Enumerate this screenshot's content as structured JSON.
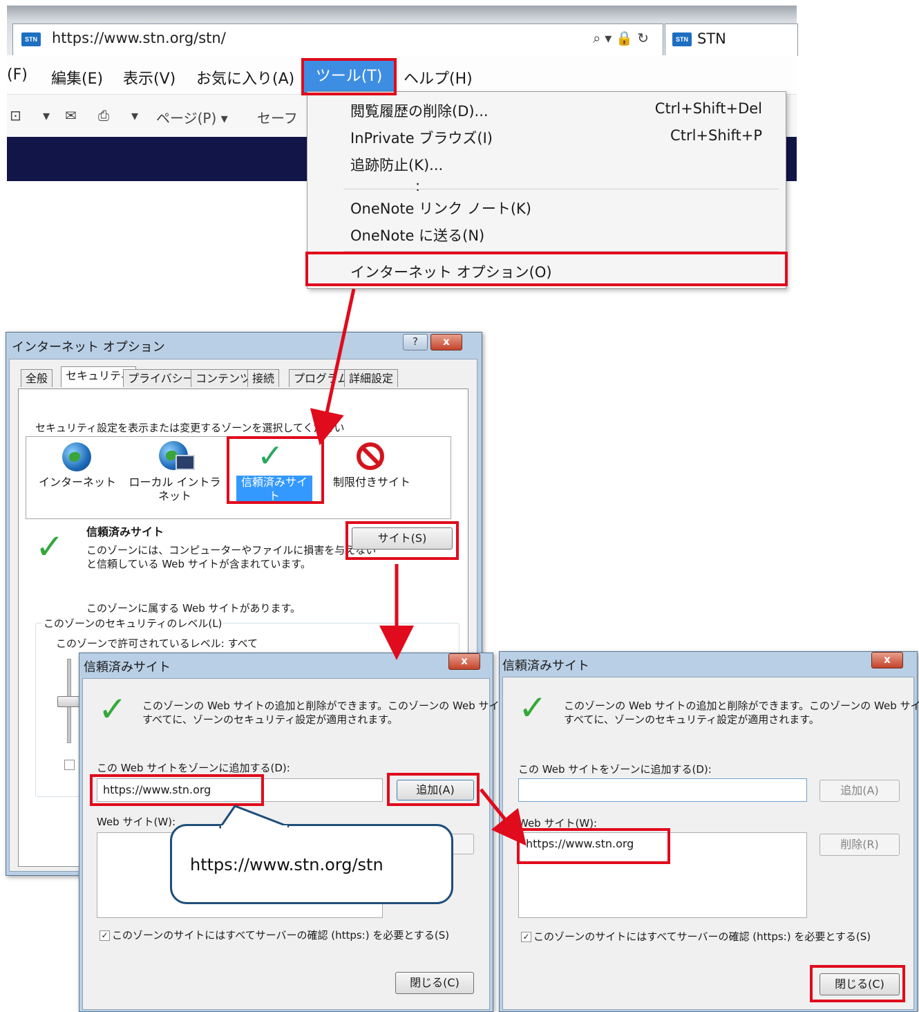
{
  "browser": {
    "url": "https://www.stn.org/stn/",
    "favicon_text": "STN",
    "tab_title": "STN",
    "address_icons": "⌕▾🔒↻"
  },
  "menubar": {
    "items": [
      "(F)",
      "編集(E)",
      "表示(V)",
      "お気に入り(A)",
      "ツール(T)",
      "ヘルプ(H)"
    ]
  },
  "toolbar": {
    "page_label": "ページ(P) ▾",
    "safety_label": "セーフ"
  },
  "tools_menu": {
    "items": [
      {
        "label": "閲覧履歴の削除(D)...",
        "shortcut": "Ctrl+Shift+Del"
      },
      {
        "label": "InPrivate ブラウズ(I)",
        "shortcut": "Ctrl+Shift+P"
      },
      {
        "label": "追跡防止(K)...",
        "shortcut": ""
      },
      {
        "label": ":",
        "shortcut": ""
      },
      {
        "label": "OneNote リンク ノート(K)",
        "shortcut": ""
      },
      {
        "label": "OneNote に送る(N)",
        "shortcut": ""
      },
      {
        "label": "インターネット オプション(O)",
        "shortcut": ""
      }
    ]
  },
  "internet_options": {
    "title": "インターネット オプション",
    "help": "?",
    "close": "x",
    "tabs": [
      "全般",
      "セキュリティ",
      "プライバシー",
      "コンテンツ",
      "接続",
      "プログラム",
      "詳細設定"
    ],
    "zone_prompt": "セキュリティ設定を表示または変更するゾーンを選択してください",
    "zones": [
      "インターネット",
      "ローカル イントラネット",
      "信頼済みサイト",
      "制限付きサイト"
    ],
    "zone_title": "信頼済みサイト",
    "zone_desc_1": "このゾーンには、コンピューターやファイルに損害を与えない",
    "zone_desc_2": "と信頼している Web サイトが含まれています。",
    "sites_button": "サイト(S)",
    "zone_has_sites": "このゾーンに属する Web サイトがあります。",
    "security_level_group": "このゾーンのセキュリティのレベル(L)",
    "allowed_level": "このゾーンで許可されているレベル: すべて"
  },
  "trusted_left": {
    "title": "信頼済みサイト",
    "close": "x",
    "description_1": "このゾーンの Web サイトの追加と削除ができます。このゾーンの Web サイト",
    "description_2": "すべてに、ゾーンのセキュリティ設定が適用されます。",
    "add_label": "この Web サイトをゾーンに追加する(D):",
    "add_value": "https://www.stn.org",
    "add_button": "追加(A)",
    "websites_label": "Web サイト(W):",
    "checkbox_label": "このゾーンのサイトにはすべてサーバーの確認 (https:) を必要とする(S)",
    "checkbox_checked": "✓",
    "close_button": "閉じる(C)"
  },
  "callout": {
    "text": "https://www.stn.org/stn"
  },
  "trusted_right": {
    "title": "信頼済みサイト",
    "close": "x",
    "description_1": "このゾーンの Web サイトの追加と削除ができます。このゾーンの Web サイト",
    "description_2": "すべてに、ゾーンのセキュリティ設定が適用されます。",
    "add_label": "この Web サイトをゾーンに追加する(D):",
    "add_value": "",
    "add_button": "追加(A)",
    "websites_label": "Web サイト(W):",
    "websites": [
      "https://www.stn.org"
    ],
    "remove_button": "削除(R)",
    "checkbox_label": "このゾーンのサイトにはすべてサーバーの確認 (https:) を必要とする(S)",
    "checkbox_checked": "✓",
    "close_button": "閉じる(C)"
  },
  "colors": {
    "highlight_red": "#e00b1c",
    "arrow_red": "#e00b1c",
    "menu_selected": "#3d8ee3",
    "navy_banner": "#121548",
    "callout_border": "#1f4e79"
  }
}
